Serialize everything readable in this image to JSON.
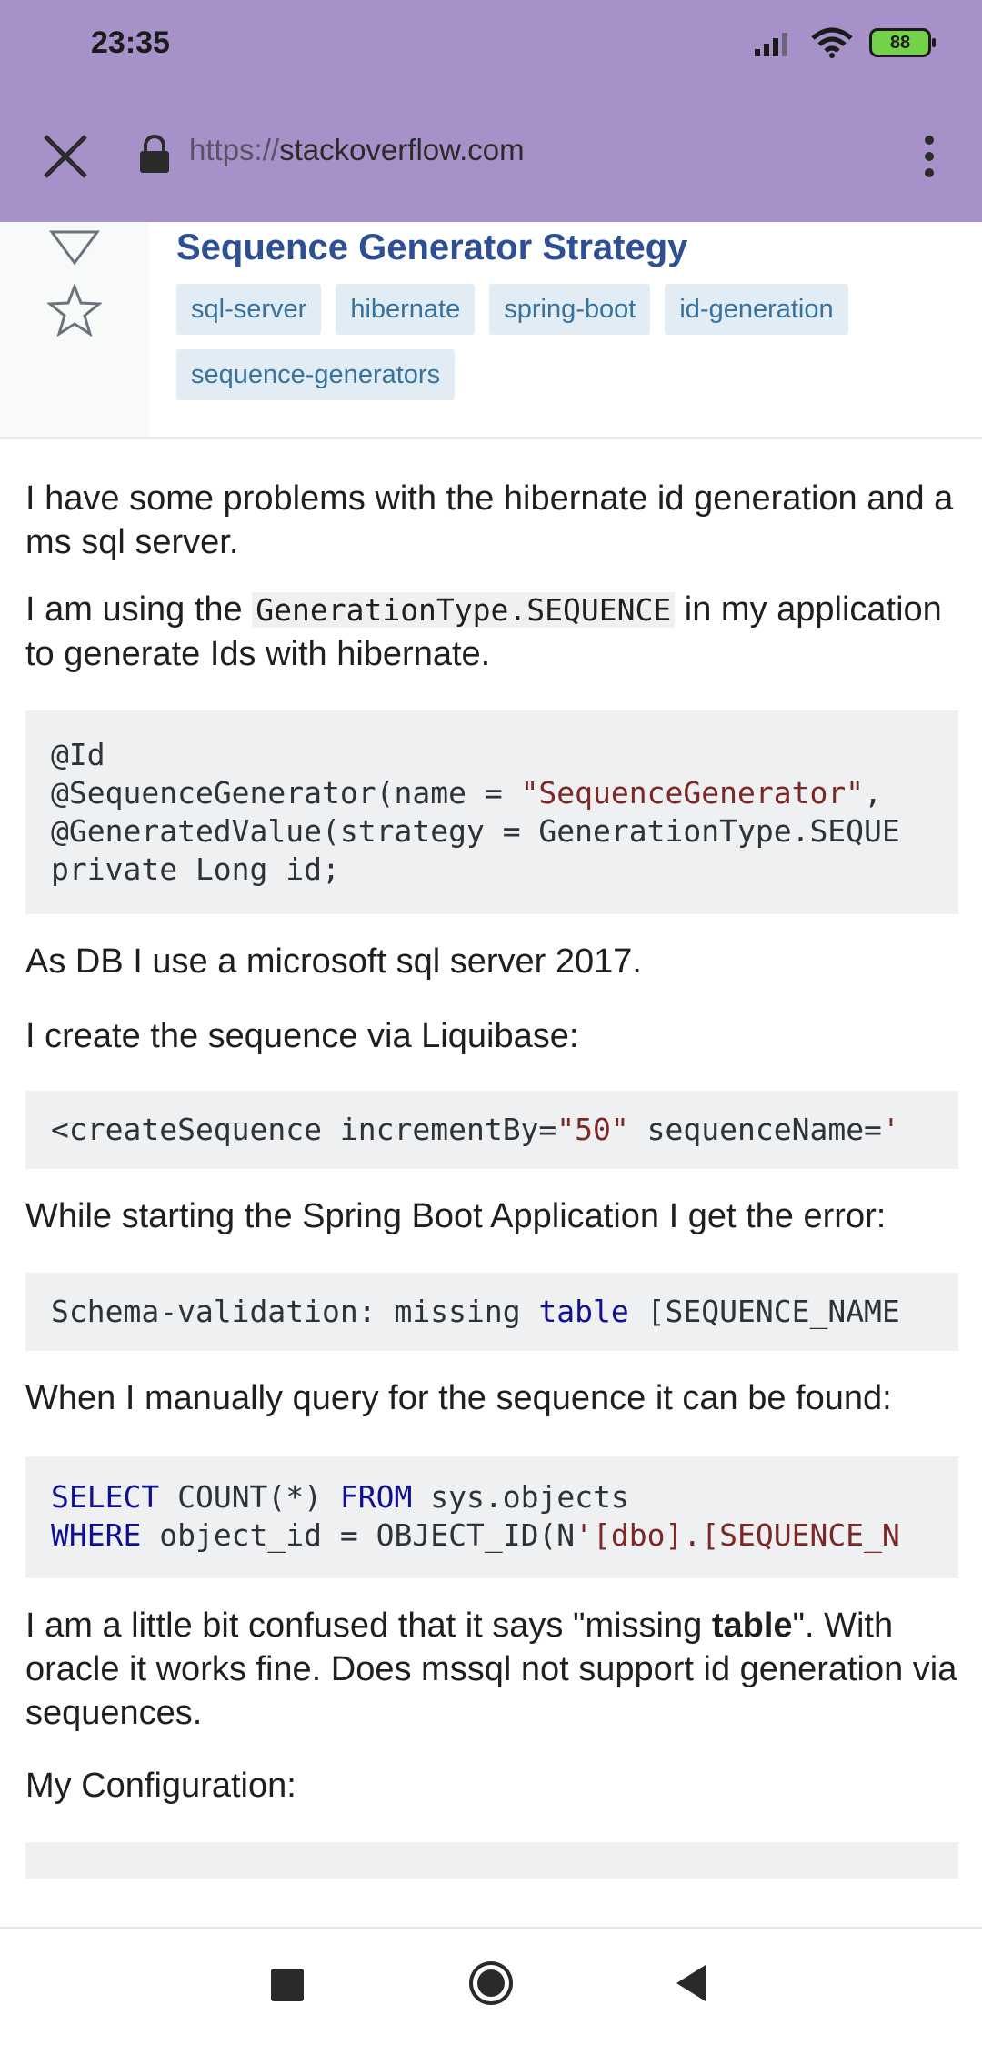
{
  "status_bar": {
    "time": "23:35",
    "battery": "88"
  },
  "browser": {
    "url_scheme": "https://",
    "url_host": "stackoverflow.com"
  },
  "question": {
    "title": "Sequence Generator Strategy",
    "tags": [
      "sql-server",
      "hibernate",
      "spring-boot",
      "id-generation",
      "sequence-generators"
    ]
  },
  "body": {
    "p1": "I have some problems with the hibernate id generation and a ms sql server.",
    "p2_before": "I am using the ",
    "p2_code": "GenerationType.SEQUENCE",
    "p2_after": " in my application to generate Ids with hibernate.",
    "code1": {
      "l1": "@Id",
      "l2a": "@SequenceGenerator(name = ",
      "l2b": "\"SequenceGenerator\"",
      "l2c": ",",
      "l3": "@GeneratedValue(strategy = GenerationType.SEQUE",
      "l4": "private Long id;"
    },
    "p3": "As DB I use a microsoft sql server 2017.",
    "p4": "I create the sequence via Liquibase:",
    "code2": {
      "a": "<createSequence incrementBy=",
      "b": "\"50\"",
      "c": " sequenceName=",
      "d": "'"
    },
    "p5": "While starting the Spring Boot Application I get the error:",
    "code3": {
      "a": "Schema-validation: missing ",
      "b": "table",
      "c": " [SEQUENCE_NAME"
    },
    "p6": "When I manually query for the sequence it can be found:",
    "code4": {
      "a": "SELECT",
      "b": " COUNT(*) ",
      "c": "FROM",
      "d": " sys.objects",
      "e": "WHERE",
      "f": " object_id = OBJECT_ID(N",
      "g": "'[dbo].[SEQUENCE_N"
    },
    "p7_before": "I am a little bit confused that it says \"missing ",
    "p7_bold": "table",
    "p7_after": "\". With oracle it works fine. Does mssql not support id generation via sequences.",
    "p8": "My Configuration:"
  }
}
